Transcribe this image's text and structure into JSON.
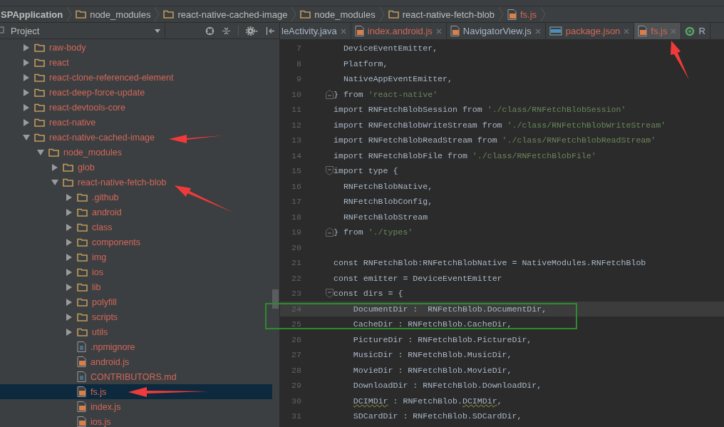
{
  "breadcrumbs": [
    {
      "kind": "project",
      "label": "SPApplication"
    },
    {
      "kind": "folder",
      "label": "node_modules"
    },
    {
      "kind": "folder",
      "label": "react-native-cached-image"
    },
    {
      "kind": "folder",
      "label": "node_modules"
    },
    {
      "kind": "folder",
      "label": "react-native-fetch-blob"
    },
    {
      "kind": "js",
      "label": "fs.js"
    }
  ],
  "project_panel": {
    "title": "Project",
    "tree": [
      {
        "label": "raw-body",
        "kind": "folder",
        "expanded": false,
        "selected": false
      },
      {
        "label": "react",
        "kind": "folder",
        "expanded": false,
        "selected": false
      },
      {
        "label": "react-clone-referenced-element",
        "kind": "folder",
        "expanded": false,
        "selected": false
      },
      {
        "label": "react-deep-force-update",
        "kind": "folder",
        "expanded": false,
        "selected": false
      },
      {
        "label": "react-devtools-core",
        "kind": "folder",
        "expanded": false,
        "selected": false
      },
      {
        "label": "react-native",
        "kind": "folder",
        "expanded": false,
        "selected": false
      },
      {
        "label": "react-native-cached-image",
        "kind": "folder",
        "expanded": true,
        "selected": false,
        "children": [
          {
            "label": "node_modules",
            "kind": "folder",
            "expanded": true,
            "selected": false,
            "children": [
              {
                "label": "glob",
                "kind": "folder",
                "expanded": false,
                "selected": false
              },
              {
                "label": "react-native-fetch-blob",
                "kind": "folder",
                "expanded": true,
                "selected": false,
                "children": [
                  {
                    "label": ".github",
                    "kind": "folder",
                    "expanded": false,
                    "selected": false
                  },
                  {
                    "label": "android",
                    "kind": "folder",
                    "expanded": false,
                    "selected": false
                  },
                  {
                    "label": "class",
                    "kind": "folder",
                    "expanded": false,
                    "selected": false
                  },
                  {
                    "label": "components",
                    "kind": "folder",
                    "expanded": false,
                    "selected": false
                  },
                  {
                    "label": "img",
                    "kind": "folder",
                    "expanded": false,
                    "selected": false
                  },
                  {
                    "label": "ios",
                    "kind": "folder",
                    "expanded": false,
                    "selected": false
                  },
                  {
                    "label": "lib",
                    "kind": "folder",
                    "expanded": false,
                    "selected": false
                  },
                  {
                    "label": "polyfill",
                    "kind": "folder",
                    "expanded": false,
                    "selected": false
                  },
                  {
                    "label": "scripts",
                    "kind": "folder",
                    "expanded": false,
                    "selected": false
                  },
                  {
                    "label": "utils",
                    "kind": "folder",
                    "expanded": false,
                    "selected": false
                  },
                  {
                    "label": ".npmignore",
                    "kind": "text",
                    "selected": false
                  },
                  {
                    "label": "android.js",
                    "kind": "js",
                    "selected": false
                  },
                  {
                    "label": "CONTRIBUTORS.md",
                    "kind": "text",
                    "selected": false
                  },
                  {
                    "label": "fs.js",
                    "kind": "js",
                    "selected": true
                  },
                  {
                    "label": "index.js",
                    "kind": "js",
                    "selected": false
                  },
                  {
                    "label": "ios.js",
                    "kind": "js",
                    "selected": false
                  }
                ]
              }
            ]
          }
        ]
      }
    ]
  },
  "tabs": [
    {
      "label": "leActivity.java",
      "selected": false,
      "color": "#a9b7c6"
    },
    {
      "label": "index.android.js",
      "kind": "js",
      "selected": false,
      "color": "#d1675a"
    },
    {
      "label": "NavigatorView.js",
      "kind": "js",
      "selected": false,
      "color": "#a9b7c6"
    },
    {
      "label": "package.json",
      "kind": "json",
      "selected": false,
      "color": "#d1675a"
    },
    {
      "label": "fs.js",
      "kind": "js",
      "selected": true,
      "color": "#d1675a"
    },
    {
      "label": "R",
      "kind": "run",
      "selected": false,
      "color": "#a9b7c6"
    }
  ],
  "editor": {
    "lines": [
      {
        "number": "7",
        "current": false,
        "segments": [
          {
            "kind": "plain",
            "text": "  DeviceEventEmitter,"
          }
        ]
      },
      {
        "number": "8",
        "current": false,
        "segments": [
          {
            "kind": "plain",
            "text": "  Platform,"
          }
        ]
      },
      {
        "number": "9",
        "current": false,
        "segments": [
          {
            "kind": "plain",
            "text": "  NativeAppEventEmitter,"
          }
        ]
      },
      {
        "number": "10",
        "current": false,
        "fold_end": true,
        "segments": [
          {
            "kind": "plain",
            "text": "} from "
          },
          {
            "kind": "string",
            "text": "'react-native'"
          }
        ]
      },
      {
        "number": "11",
        "current": false,
        "segments": [
          {
            "kind": "plain",
            "text": "import RNFetchBlobSession from "
          },
          {
            "kind": "string",
            "text": "'./class/RNFetchBlobSession'"
          }
        ]
      },
      {
        "number": "12",
        "current": false,
        "segments": [
          {
            "kind": "plain",
            "text": "import RNFetchBlobWriteStream from "
          },
          {
            "kind": "string",
            "text": "'./class/RNFetchBlobWriteStream'"
          }
        ]
      },
      {
        "number": "13",
        "current": false,
        "segments": [
          {
            "kind": "plain",
            "text": "import RNFetchBlobReadStream from "
          },
          {
            "kind": "string",
            "text": "'./class/RNFetchBlobReadStream'"
          }
        ]
      },
      {
        "number": "14",
        "current": false,
        "segments": [
          {
            "kind": "plain",
            "text": "import RNFetchBlobFile from "
          },
          {
            "kind": "string",
            "text": "'./class/RNFetchBlobFile'"
          }
        ]
      },
      {
        "number": "15",
        "current": false,
        "fold_start": true,
        "segments": [
          {
            "kind": "plain",
            "text": "import type {"
          }
        ]
      },
      {
        "number": "16",
        "current": false,
        "segments": [
          {
            "kind": "plain",
            "text": "  RNFetchBlobNative,"
          }
        ]
      },
      {
        "number": "17",
        "current": false,
        "segments": [
          {
            "kind": "plain",
            "text": "  RNFetchBlobConfig,"
          }
        ]
      },
      {
        "number": "18",
        "current": false,
        "segments": [
          {
            "kind": "plain",
            "text": "  RNFetchBlobStream"
          }
        ]
      },
      {
        "number": "19",
        "current": false,
        "fold_end": true,
        "segments": [
          {
            "kind": "plain",
            "text": "} from "
          },
          {
            "kind": "string",
            "text": "'./types'"
          }
        ]
      },
      {
        "number": "20",
        "current": false
      },
      {
        "number": "21",
        "current": false,
        "segments": [
          {
            "kind": "plain",
            "text": "const RNFetchBlob:RNFetchBlobNative = NativeModules.RNFetchBlob"
          }
        ]
      },
      {
        "number": "22",
        "current": false,
        "segments": [
          {
            "kind": "plain",
            "text": "const emitter = DeviceEventEmitter"
          }
        ]
      },
      {
        "number": "23",
        "current": false,
        "fold_start": true,
        "segments": [
          {
            "kind": "plain",
            "text": "const dirs = {"
          }
        ]
      },
      {
        "number": "24",
        "current": true,
        "segments": [
          {
            "kind": "plain",
            "text": "    DocumentDir :  RNFetchBlob.DocumentDir,"
          }
        ]
      },
      {
        "number": "25",
        "current": false,
        "segments": [
          {
            "kind": "plain",
            "text": "    CacheDir : RNFetchBlob.CacheDir,"
          }
        ]
      },
      {
        "number": "26",
        "current": false,
        "segments": [
          {
            "kind": "plain",
            "text": "    PictureDir : RNFetchBlob.PictureDir,"
          }
        ]
      },
      {
        "number": "27",
        "current": false,
        "segments": [
          {
            "kind": "plain",
            "text": "    MusicDir : RNFetchBlob.MusicDir,"
          }
        ]
      },
      {
        "number": "28",
        "current": false,
        "segments": [
          {
            "kind": "plain",
            "text": "    MovieDir : RNFetchBlob.MovieDir,"
          }
        ]
      },
      {
        "number": "29",
        "current": false,
        "segments": [
          {
            "kind": "plain",
            "text": "    DownloadDir : RNFetchBlob.DownloadDir,"
          }
        ]
      },
      {
        "number": "30",
        "current": false,
        "segments": [
          {
            "kind": "typo",
            "text": "    DCIMDir"
          },
          {
            "kind": "plain",
            "text": " : RNFetchBlob."
          },
          {
            "kind": "typo",
            "text": "DCIMDir"
          },
          {
            "kind": "plain",
            "text": ","
          }
        ]
      },
      {
        "number": "31",
        "current": false,
        "segments": [
          {
            "kind": "plain",
            "text": "    SDCardDir : RNFetchBlob.SDCardDir,"
          }
        ]
      }
    ]
  }
}
